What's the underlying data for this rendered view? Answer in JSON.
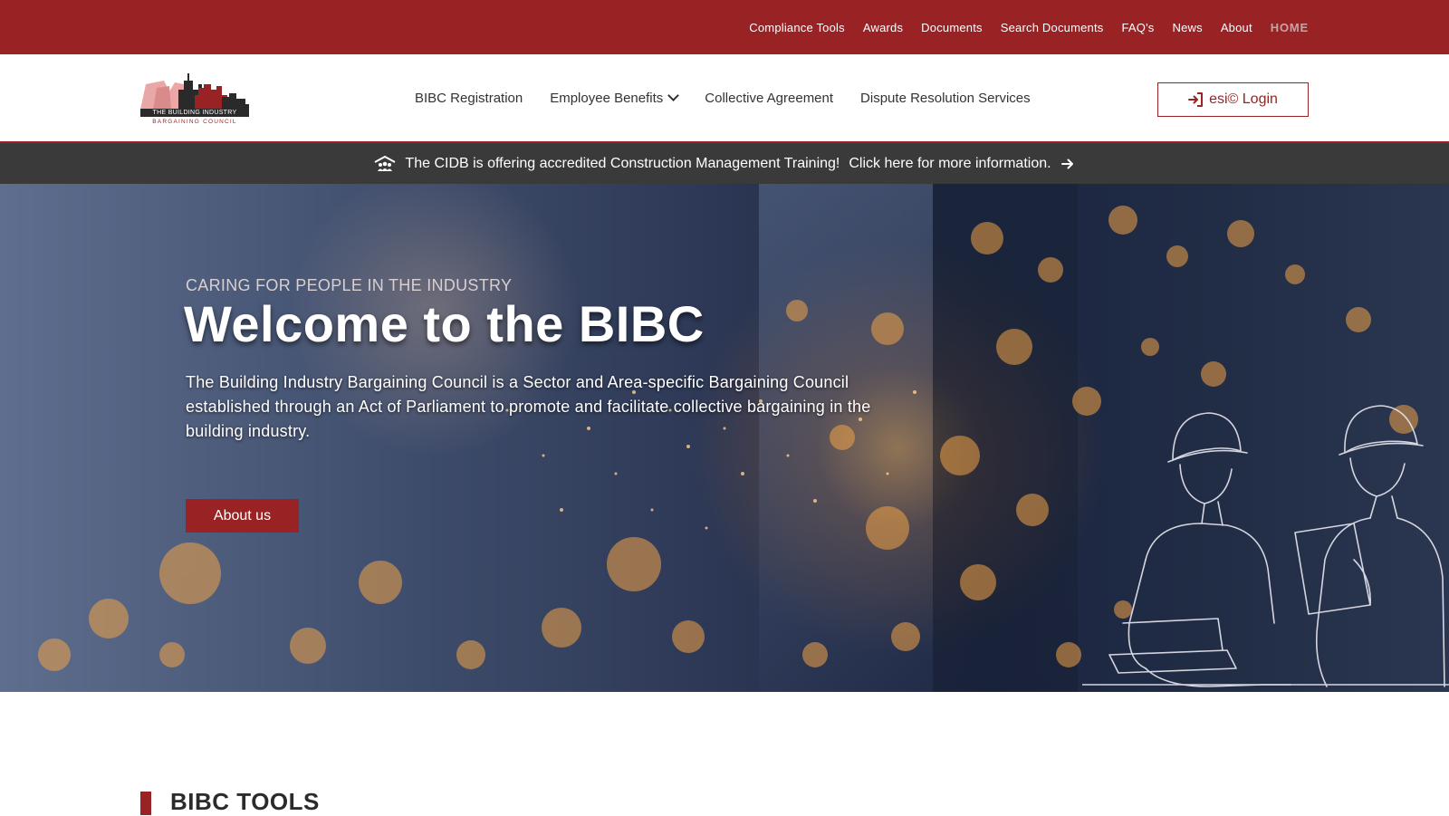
{
  "topnav": {
    "items": [
      "Compliance Tools",
      "Awards",
      "Documents",
      "Search Documents",
      "FAQ's",
      "News",
      "About",
      "HOME"
    ]
  },
  "logo": {
    "line1": "THE BUILDING INDUSTRY",
    "line2": "BARGAINING COUNCIL"
  },
  "mainnav": {
    "items": [
      "BIBC Registration",
      "Employee Benefits",
      "Collective Agreement",
      "Dispute Resolution Services"
    ]
  },
  "login": {
    "label": "esi© Login"
  },
  "announcement": {
    "text": "The CIDB is offering accredited Construction Management Training!",
    "link": "Click here for more information."
  },
  "hero": {
    "kicker": "CARING FOR PEOPLE IN THE INDUSTRY",
    "title": "Welcome to the BIBC",
    "text": "The Building Industry Bargaining Council is a Sector and Area-specific Bargaining Council established through an Act of Parliament to promote and facilitate collective bargaining in the building industry.",
    "button": "About us"
  },
  "tools": {
    "title": "BIBC TOOLS"
  },
  "icons": {
    "announcement": "people-roof-icon",
    "announcement_arrow": "arrow-right-icon",
    "login": "sign-in-icon",
    "dropdown": "chevron-down-icon"
  },
  "colors": {
    "brand": "#982224",
    "announcement_bg": "#3a3a3a",
    "active_nav": "#c9a3a4"
  }
}
